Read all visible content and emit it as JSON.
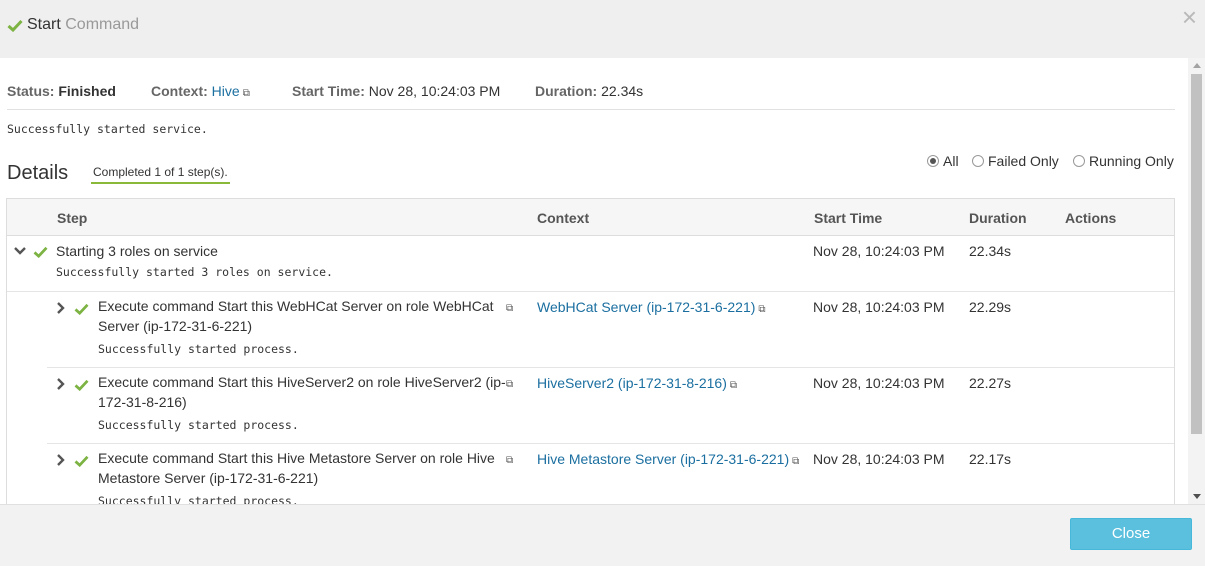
{
  "header": {
    "title_main": "Start",
    "title_sub": "Command"
  },
  "status": {
    "status_label": "Status:",
    "status_value": "Finished",
    "context_label": "Context:",
    "context_value": "Hive",
    "start_label": "Start Time:",
    "start_value": "Nov 28, 10:24:03 PM",
    "duration_label": "Duration:",
    "duration_value": "22.34s"
  },
  "summary": "Successfully started service.",
  "details": {
    "title": "Details",
    "completed": "Completed 1 of 1 step(s).",
    "filters": {
      "all": "All",
      "failed": "Failed Only",
      "running": "Running Only",
      "selected": "All"
    }
  },
  "table": {
    "headers": {
      "step": "Step",
      "context": "Context",
      "start_time": "Start Time",
      "duration": "Duration",
      "actions": "Actions"
    },
    "parent": {
      "step": "Starting 3 roles on service",
      "message": "Successfully started 3 roles on service.",
      "start_time": "Nov 28, 10:24:03 PM",
      "duration": "22.34s"
    },
    "children": [
      {
        "step_line1": "Execute command Start this WebHCat Server on role WebHCat",
        "step_line2": "Server (ip-172-31-6-221)",
        "message": "Successfully started process.",
        "context": "WebHCat Server (ip-172-31-6-221)",
        "start_time": "Nov 28, 10:24:03 PM",
        "duration": "22.29s"
      },
      {
        "step_line1": "Execute command Start this HiveServer2 on role HiveServer2 (ip-",
        "step_line2": "172-31-8-216)",
        "message": "Successfully started process.",
        "context": "HiveServer2 (ip-172-31-8-216)",
        "start_time": "Nov 28, 10:24:03 PM",
        "duration": "22.27s"
      },
      {
        "step_line1": "Execute command Start this Hive Metastore Server on role Hive",
        "step_line2": "Metastore Server (ip-172-31-6-221)",
        "message": "Successfully started process.",
        "context": "Hive Metastore Server (ip-172-31-6-221)",
        "start_time": "Nov 28, 10:24:03 PM",
        "duration": "22.17s"
      }
    ]
  },
  "footer": {
    "close_label": "Close"
  },
  "colors": {
    "success": "#7cb342",
    "link": "#1b6fa0",
    "button": "#5bc0de"
  }
}
